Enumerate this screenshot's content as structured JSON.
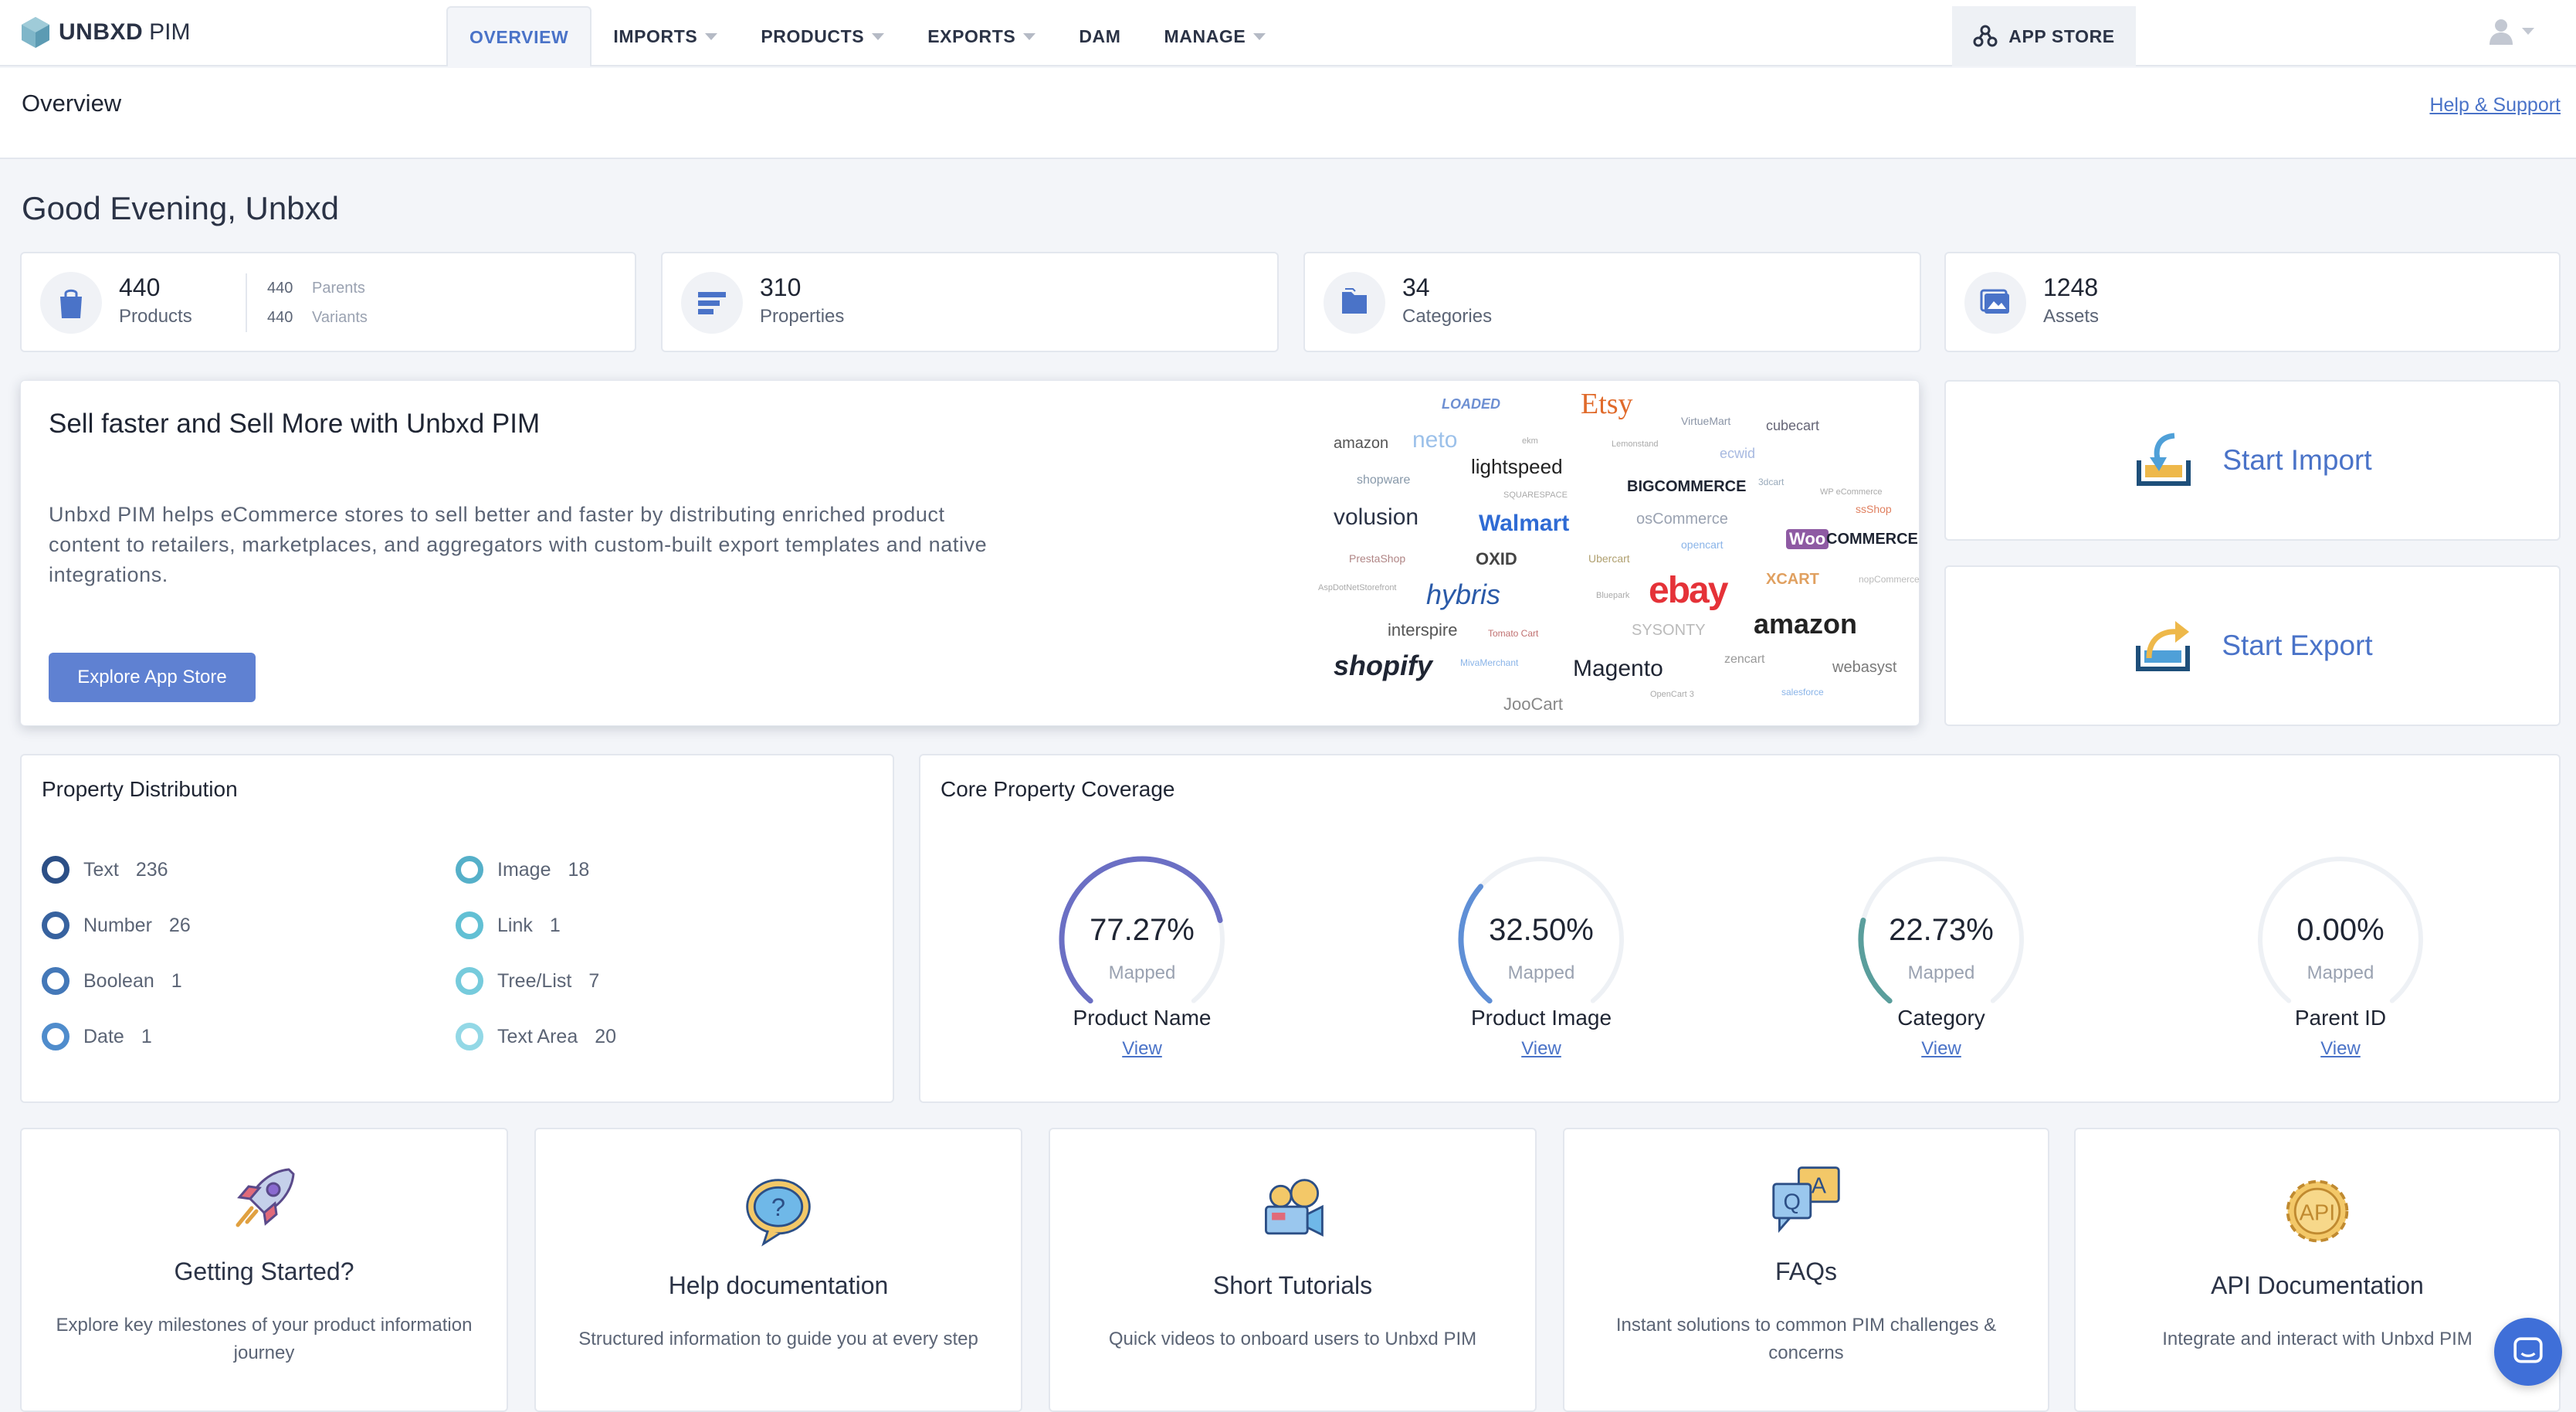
{
  "app": {
    "brand": "UNBXD",
    "brand_sub": "PIM"
  },
  "nav": {
    "tabs": [
      {
        "label": "OVERVIEW",
        "active": true
      },
      {
        "label": "IMPORTS",
        "dropdown": true
      },
      {
        "label": "PRODUCTS",
        "dropdown": true
      },
      {
        "label": "EXPORTS",
        "dropdown": true
      },
      {
        "label": "DAM"
      },
      {
        "label": "MANAGE",
        "dropdown": true
      }
    ],
    "app_store": "APP STORE",
    "user_icon": "user-icon"
  },
  "header": {
    "title": "Overview",
    "help_link": "Help & Support"
  },
  "greeting": "Good Evening, Unbxd",
  "stats": {
    "products": {
      "value": "440",
      "label": "Products",
      "parents_value": "440",
      "parents_label": "Parents",
      "variants_value": "440",
      "variants_label": "Variants",
      "icon": "shopping-bag-icon"
    },
    "properties": {
      "value": "310",
      "label": "Properties",
      "icon": "properties-icon"
    },
    "categories": {
      "value": "34",
      "label": "Categories",
      "icon": "folder-icon"
    },
    "assets": {
      "value": "1248",
      "label": "Assets",
      "icon": "image-icon"
    }
  },
  "promo": {
    "title": "Sell faster and Sell More with Unbxd PIM",
    "description": "Unbxd PIM helps eCommerce stores to sell better and faster by distributing enriched product content to retailers, marketplaces, and aggregators with custom-built export templates and native integrations.",
    "button": "Explore App Store",
    "logos": {
      "etsy": "Etsy",
      "loaded": "LOADED",
      "amazon_small": "amazon",
      "neto": "neto",
      "virtuemart": "VirtueMart",
      "cubecart": "cubecart",
      "lightspeed": "lightspeed",
      "ecwid": "ecwid",
      "shopware": "shopware",
      "bigcommerce": "BIGCOMMERCE",
      "volusion": "volusion",
      "walmart": "Walmart",
      "oscommerce": "osCommerce",
      "woocommerce": "COMMERCE",
      "woo": "Woo",
      "prestashop": "PrestaShop",
      "oxid": "OXID",
      "ubercart": "Ubercart",
      "opencart": "opencart",
      "hybris": "hybris",
      "ebay": "ebay",
      "xcart": "XCART",
      "interspire": "interspire",
      "zencart": "zencart",
      "amazon": "amazon",
      "shopify": "shopify",
      "magento": "Magento",
      "webasyst": "webasyst",
      "joocart": "JooCart",
      "nopcommerce": "nopCommerce",
      "shopshop": "ssShop",
      "wpecommerce": "WP eCommerce",
      "sysonty": "SYSONTY",
      "lemonstand": "Lemonstand",
      "aspdotnet": "AspDotNetStorefront",
      "ekm": "ekm",
      "salesforce": "salesforce",
      "tomatocart": "Tomato Cart",
      "miva": "MivaMerchant",
      "squarespace": "SQUARESPACE",
      "3dcart": "3dcart",
      "bluepark": "Bluepark",
      "opencart3": "OpenCart 3"
    }
  },
  "actions": {
    "import": "Start Import",
    "export": "Start Export"
  },
  "property_distribution": {
    "title": "Property Distribution",
    "items": [
      {
        "label": "Text",
        "value": "236",
        "color": "#2c4f86"
      },
      {
        "label": "Number",
        "value": "26",
        "color": "#37629f"
      },
      {
        "label": "Boolean",
        "value": "1",
        "color": "#4478b8"
      },
      {
        "label": "Date",
        "value": "1",
        "color": "#4f8ccc"
      },
      {
        "label": "Image",
        "value": "18",
        "color": "#55b0c9"
      },
      {
        "label": "Link",
        "value": "1",
        "color": "#62c0d4"
      },
      {
        "label": "Tree/List",
        "value": "7",
        "color": "#76cbdc"
      },
      {
        "label": "Text Area",
        "value": "20",
        "color": "#93d8e6"
      }
    ]
  },
  "coverage": {
    "title": "Core Property Coverage",
    "gauges": [
      {
        "value": "77.27%",
        "fraction": 0.7727,
        "sub": "Mapped",
        "name": "Product Name",
        "link": "View",
        "color": "#6b6fc4"
      },
      {
        "value": "32.50%",
        "fraction": 0.325,
        "sub": "Mapped",
        "name": "Product Image",
        "link": "View",
        "color": "#5f8fd6"
      },
      {
        "value": "22.73%",
        "fraction": 0.2273,
        "sub": "Mapped",
        "name": "Category",
        "link": "View",
        "color": "#5a9e9c"
      },
      {
        "value": "0.00%",
        "fraction": 0.0,
        "sub": "Mapped",
        "name": "Parent ID",
        "link": "View",
        "color": "#5f8fd6"
      }
    ],
    "track_color": "#eef1f5"
  },
  "resources": [
    {
      "title": "Getting Started?",
      "desc": "Explore key milestones of your product information journey",
      "icon": "rocket-icon"
    },
    {
      "title": "Help documentation",
      "desc": "Structured information to guide you at every step",
      "icon": "help-bubble-icon"
    },
    {
      "title": "Short Tutorials",
      "desc": "Quick videos to onboard users to Unbxd PIM",
      "icon": "video-camera-icon"
    },
    {
      "title": "FAQs",
      "desc": "Instant solutions to common PIM challenges & concerns",
      "icon": "faq-icon"
    },
    {
      "title": "API Documentation",
      "desc": "Integrate and interact with Unbxd PIM",
      "icon": "api-gear-icon"
    }
  ],
  "chat_icon": "chat-icon"
}
